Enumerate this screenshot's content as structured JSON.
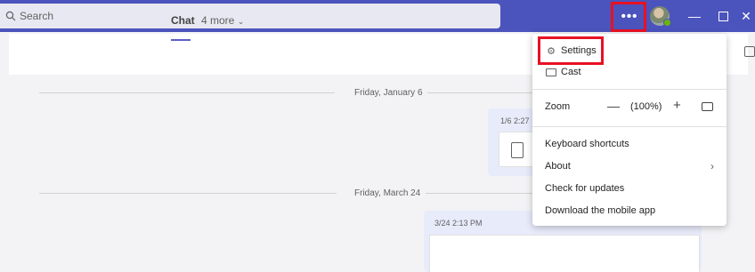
{
  "titlebar": {
    "search_placeholder": "Search",
    "more_label": "•••",
    "minimize_label": "—",
    "maximize_label": "",
    "close_label": "✕"
  },
  "chat_header": {
    "tab_chat": "Chat",
    "tab_more": "4 more"
  },
  "messages": {
    "date1": "Friday, January 6",
    "time1": "1/6 2:27",
    "date2": "Friday, March 24",
    "time2": "3/24 2:13 PM"
  },
  "menu": {
    "settings": "Settings",
    "cast": "Cast",
    "zoom_label": "Zoom",
    "zoom_minus": "—",
    "zoom_value": "(100%)",
    "zoom_plus": "+",
    "keyboard_shortcuts": "Keyboard shortcuts",
    "about": "About",
    "check_updates": "Check for updates",
    "download_mobile": "Download the mobile app"
  },
  "colors": {
    "titlebar": "#4b53bc",
    "highlight": "#e81123",
    "accent": "#5b5fc7"
  }
}
